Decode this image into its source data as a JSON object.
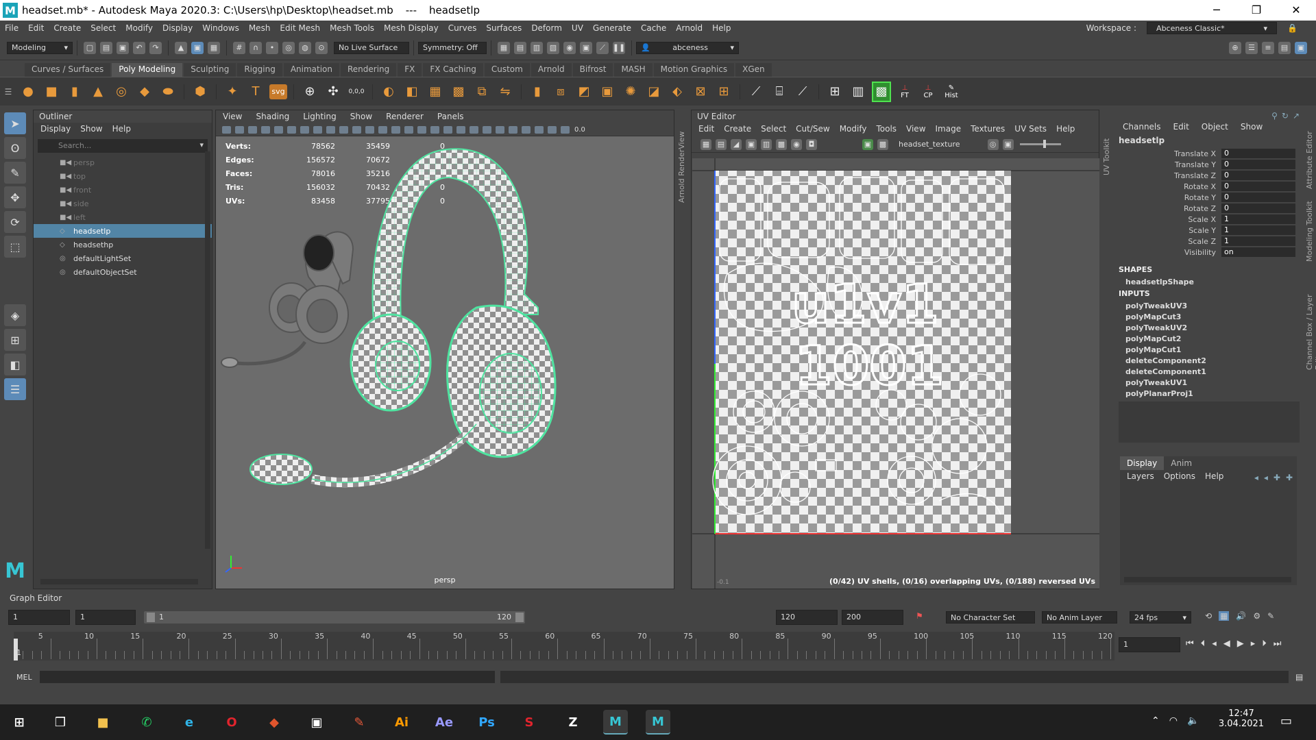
{
  "title": {
    "text": "headset.mb* - Autodesk Maya 2020.3: C:\\Users\\hp\\Desktop\\headset.mb",
    "sep": "---",
    "object": "headsetlp",
    "controls": [
      "─",
      "❐",
      "✕"
    ]
  },
  "menu": [
    "File",
    "Edit",
    "Create",
    "Select",
    "Modify",
    "Display",
    "Windows",
    "Mesh",
    "Edit Mesh",
    "Mesh Tools",
    "Mesh Display",
    "Curves",
    "Surfaces",
    "Deform",
    "UV",
    "Generate",
    "Cache",
    "Arnold",
    "Help"
  ],
  "workspace": {
    "label": "Workspace :",
    "value": "Abceness Classic*"
  },
  "status": {
    "mode": "Modeling",
    "live_surface": "No Live Surface",
    "symmetry": "Symmetry: Off",
    "user": "abceness"
  },
  "shelf_tabs": [
    "Curves / Surfaces",
    "Poly Modeling",
    "Sculpting",
    "Rigging",
    "Animation",
    "Rendering",
    "FX",
    "FX Caching",
    "Custom",
    "Arnold",
    "Bifrost",
    "MASH",
    "Motion Graphics",
    "XGen"
  ],
  "shelf_active": "Poly Modeling",
  "shelf_labels": {
    "t": "T",
    "svg": "svg",
    "ft": "FT",
    "cp": "CP",
    "hist": "Hist",
    "coord": "0,0,0"
  },
  "outliner": {
    "title": "Outliner",
    "menu": [
      "Display",
      "Show",
      "Help"
    ],
    "search": "Search...",
    "items": [
      {
        "name": "persp",
        "dim": true,
        "icon": "cam"
      },
      {
        "name": "top",
        "dim": true,
        "icon": "cam"
      },
      {
        "name": "front",
        "dim": true,
        "icon": "cam"
      },
      {
        "name": "side",
        "dim": true,
        "icon": "cam"
      },
      {
        "name": "left",
        "dim": true,
        "icon": "cam"
      },
      {
        "name": "headsetlp",
        "sel": true,
        "icon": "mesh"
      },
      {
        "name": "headsethp",
        "icon": "mesh"
      },
      {
        "name": "defaultLightSet",
        "icon": "set"
      },
      {
        "name": "defaultObjectSet",
        "icon": "set"
      }
    ]
  },
  "viewport": {
    "menu": [
      "View",
      "Shading",
      "Lighting",
      "Show",
      "Renderer",
      "Panels"
    ],
    "camera": "persp",
    "toolbar_value": "0.0",
    "hud": [
      {
        "label": "Verts:",
        "a": "78562",
        "b": "35459",
        "c": "0"
      },
      {
        "label": "Edges:",
        "a": "156572",
        "b": "70672",
        "c": "0"
      },
      {
        "label": "Faces:",
        "a": "78016",
        "b": "35216",
        "c": "0"
      },
      {
        "label": "Tris:",
        "a": "156032",
        "b": "70432",
        "c": "0"
      },
      {
        "label": "UVs:",
        "a": "83458",
        "b": "37795",
        "c": "0"
      }
    ]
  },
  "side_tabs": {
    "arnold": "Arnold RenderView",
    "uvtoolkit": "UV Toolkit",
    "attr": "Attribute Editor",
    "modeling": "Modeling Toolkit",
    "channel": "Channel Box / Layer Editor"
  },
  "uv_editor": {
    "title": "UV Editor",
    "menu": [
      "Edit",
      "Create",
      "Select",
      "Cut/Sew",
      "Modify",
      "Tools",
      "View",
      "Image",
      "Textures",
      "UV Sets",
      "Help"
    ],
    "texture": "headset_texture",
    "tile_top": "u1v1",
    "tile_bottom": "1001",
    "origin": "-0.1",
    "status": "(0/42) UV shells, (0/16) overlapping UVs, (0/188) reversed UVs"
  },
  "channel_box": {
    "menu": [
      "Channels",
      "Edit",
      "Object",
      "Show"
    ],
    "object": "headsetlp",
    "channels": [
      {
        "name": "Translate X",
        "value": "0"
      },
      {
        "name": "Translate Y",
        "value": "0"
      },
      {
        "name": "Translate Z",
        "value": "0"
      },
      {
        "name": "Rotate X",
        "value": "0"
      },
      {
        "name": "Rotate Y",
        "value": "0"
      },
      {
        "name": "Rotate Z",
        "value": "0"
      },
      {
        "name": "Scale X",
        "value": "1"
      },
      {
        "name": "Scale Y",
        "value": "1"
      },
      {
        "name": "Scale Z",
        "value": "1"
      },
      {
        "name": "Visibility",
        "value": "on"
      }
    ],
    "shapes_label": "SHAPES",
    "shape": "headsetlpShape",
    "inputs_label": "INPUTS",
    "inputs": [
      "polyTweakUV3",
      "polyMapCut3",
      "polyTweakUV2",
      "polyMapCut2",
      "polyMapCut1",
      "deleteComponent2",
      "deleteComponent1",
      "polyTweakUV1",
      "polyPlanarProj1"
    ]
  },
  "layers": {
    "tabs": [
      "Display",
      "Anim"
    ],
    "menu": [
      "Layers",
      "Options",
      "Help"
    ]
  },
  "graph_editor": "Graph Editor",
  "range": {
    "start": "1",
    "inner_start": "1",
    "slider_start": "1",
    "slider_end": "120",
    "end": "120",
    "outer_end": "200",
    "character": "No Character Set",
    "anim_layer": "No Anim Layer",
    "fps": "24 fps"
  },
  "timeline": {
    "labels": [
      "5",
      "10",
      "15",
      "20",
      "25",
      "30",
      "35",
      "40",
      "45",
      "50",
      "55",
      "60",
      "65",
      "70",
      "75",
      "80",
      "85",
      "90",
      "95",
      "100",
      "105",
      "110",
      "115",
      "120"
    ],
    "current": "1",
    "current_frame": "1"
  },
  "mel": {
    "label": "MEL"
  },
  "taskbar": {
    "time": "12:47",
    "date": "3.04.2021",
    "apps": [
      {
        "name": "start",
        "glyph": "⊞",
        "color": "#ffffff"
      },
      {
        "name": "taskview",
        "glyph": "❒",
        "color": "#ffffff"
      },
      {
        "name": "explorer",
        "glyph": "■",
        "color": "#f2c14e"
      },
      {
        "name": "whatsapp",
        "glyph": "✆",
        "color": "#25d366"
      },
      {
        "name": "edge",
        "glyph": "e",
        "color": "#2fb4e8"
      },
      {
        "name": "opera",
        "glyph": "O",
        "color": "#e0242d"
      },
      {
        "name": "substance-painter",
        "glyph": "◆",
        "color": "#e0552d"
      },
      {
        "name": "substance-designer",
        "glyph": "▣",
        "color": "#ffffff"
      },
      {
        "name": "pen-app",
        "glyph": "✎",
        "color": "#e85a3a"
      },
      {
        "name": "illustrator",
        "glyph": "Ai",
        "color": "#ff9a00"
      },
      {
        "name": "after-effects",
        "glyph": "Ae",
        "color": "#9999ff"
      },
      {
        "name": "photoshop",
        "glyph": "Ps",
        "color": "#31a8ff"
      },
      {
        "name": "substance",
        "glyph": "S",
        "color": "#e0242d"
      },
      {
        "name": "zbrush",
        "glyph": "Z",
        "color": "#ffffff"
      },
      {
        "name": "maya",
        "glyph": "M",
        "color": "#37c6d4"
      },
      {
        "name": "maya-2",
        "glyph": "M",
        "color": "#37c6d4"
      }
    ]
  },
  "colors": {
    "accent": "#5285a6",
    "wire": "#4fe3a0",
    "checker_a": "#f0f0f0",
    "checker_b": "#9a9a9a"
  }
}
